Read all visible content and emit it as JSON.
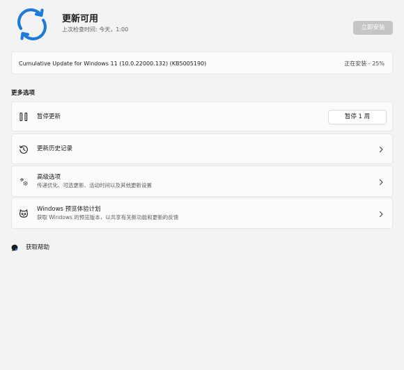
{
  "header": {
    "title": "更新可用",
    "last_checked": "上次检查时间: 今天，1:00",
    "install_now_label": "立即安装"
  },
  "update": {
    "name": "Cumulative Update for Windows 11 (10.0.22000.132) (KB5005190)",
    "status": "正在安装 - 25%",
    "progress_percent": 25
  },
  "more_options": {
    "section_title": "更多选项",
    "pause": {
      "label": "暂停更新",
      "button_label": "暂停 1 周",
      "icon": "pause-icon"
    },
    "history": {
      "label": "更新历史记录",
      "icon": "history-icon"
    },
    "advanced": {
      "label": "高级选项",
      "description": "传递优化、可选更新、活动时间以及其他更新设置",
      "icon": "gears-icon"
    },
    "insider": {
      "label": "Windows 预览体验计划",
      "description": "获取 Windows 的预览版本，以共享有关新功能和更新的反馈",
      "icon": "insider-cat-icon"
    }
  },
  "help": {
    "label": "获取帮助",
    "icon": "help-icon"
  },
  "colors": {
    "accent": "#1f7ad8",
    "disabled_button": "#c5c5c5",
    "background": "#f3f3f3",
    "card": "#fbfbfb"
  }
}
